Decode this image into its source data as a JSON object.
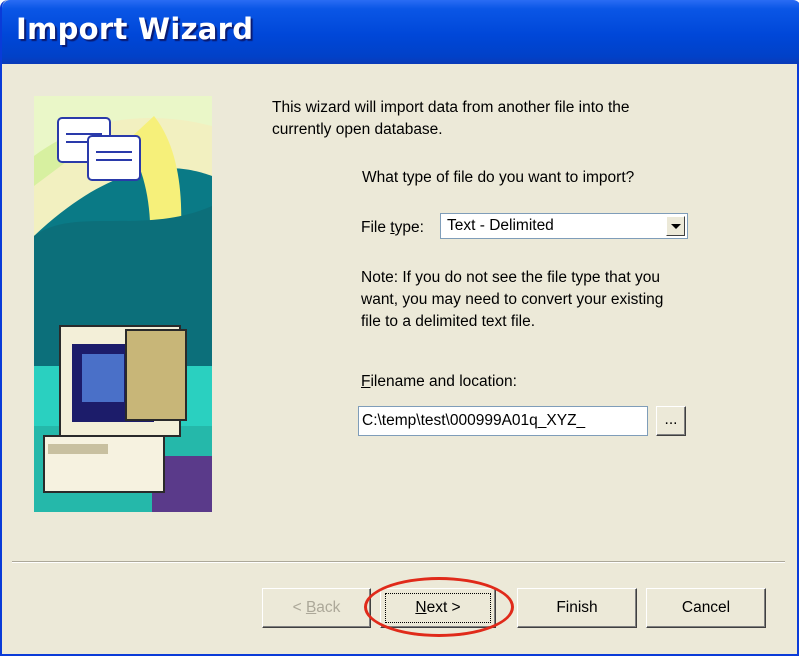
{
  "window": {
    "title": "Import Wizard"
  },
  "intro": {
    "line1": "This wizard will import data from another file into the",
    "line2": "currently open database."
  },
  "question": "What type of file do you want to import?",
  "file_type": {
    "label_pre": "File ",
    "label_u": "t",
    "label_post": "ype:",
    "value": "Text - Delimited"
  },
  "note": {
    "line1": "Note:  If you do not see the file type that you",
    "line2": "want, you may need to convert your existing",
    "line3": "file to a delimited text file."
  },
  "filename": {
    "label_u": "F",
    "label_post": "ilename and location:",
    "value": "C:\\temp\\test\\000999A01q_XYZ_",
    "browse_label": "..."
  },
  "buttons": {
    "back": {
      "pre": "< ",
      "u": "B",
      "post": "ack"
    },
    "next": {
      "u": "N",
      "post": "ext >"
    },
    "finish": "Finish",
    "cancel": "Cancel"
  },
  "icons": [
    "wizard-illustration",
    "computer-icon",
    "database-card-icon",
    "arrow-icon",
    "chevron-down-icon"
  ],
  "colors": {
    "title_bar": "#0047d8",
    "dialog_bg": "#ece9d8",
    "highlight": "#e02a1a"
  }
}
